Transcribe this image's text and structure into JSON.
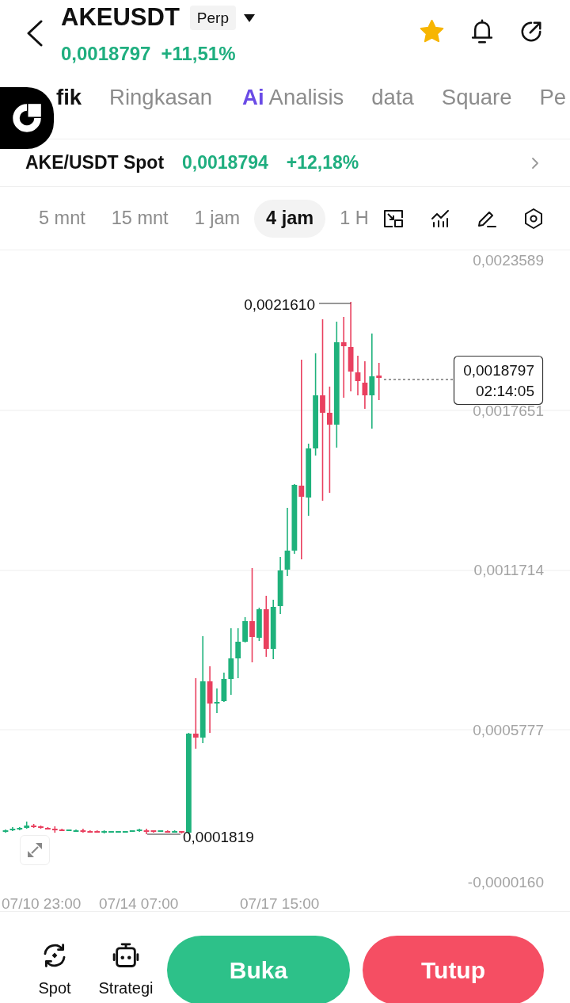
{
  "header": {
    "title": "AKEUSDT",
    "badge": "Perp",
    "price": "0,0018797",
    "change": "+11,51%",
    "favorite": true
  },
  "tabs": [
    {
      "label": "fik",
      "kind": "plain",
      "selected": true
    },
    {
      "label": "Ringkasan",
      "kind": "plain",
      "selected": false
    },
    {
      "label": "Analisis",
      "kind": "ai",
      "prefix": "Ai",
      "selected": false
    },
    {
      "label": "data",
      "kind": "plain",
      "selected": false
    },
    {
      "label": "Square",
      "kind": "plain",
      "selected": false
    },
    {
      "label": "Pe",
      "kind": "plain",
      "selected": false
    }
  ],
  "spot_bar": {
    "pair": "AKE/USDT Spot",
    "price": "0,0018794",
    "change": "+12,18%"
  },
  "timeframes": [
    {
      "label": "5 mnt",
      "selected": false
    },
    {
      "label": "15 mnt",
      "selected": false
    },
    {
      "label": "1 jam",
      "selected": false
    },
    {
      "label": "4 jam",
      "selected": true
    },
    {
      "label": "1 H",
      "selected": false
    }
  ],
  "chart": {
    "y_axis": [
      "0,0023589",
      "0,0017651",
      "0,0011714",
      "0,0005777",
      "-0,0000160"
    ],
    "x_axis": [
      "07/10 23:00",
      "07/14 07:00",
      "07/17 15:00"
    ],
    "high_label": "0,0021610",
    "low_label": "0,0001819",
    "last_price": "0,0018797",
    "countdown": "02:14:05"
  },
  "bottom_bar": {
    "shortcuts": [
      {
        "label": "Spot",
        "kind": "spot"
      },
      {
        "label": "Strategi",
        "kind": "strategy"
      }
    ],
    "buttons": [
      {
        "label": "Buka",
        "kind": "open"
      },
      {
        "label": "Tutup",
        "kind": "close"
      }
    ]
  }
}
